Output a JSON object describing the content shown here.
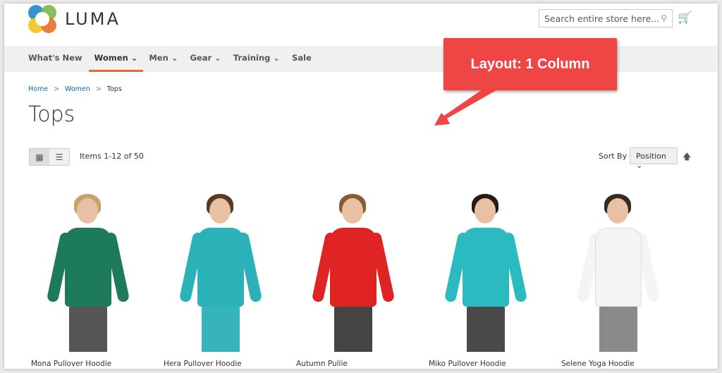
{
  "header": {
    "logo_text": "LUMA",
    "search_placeholder": "Search entire store here...",
    "icons": {
      "search": "search-icon",
      "cart": "cart-icon"
    }
  },
  "nav": {
    "items": [
      {
        "label": "What's New"
      },
      {
        "label": "Women",
        "caret": "⌄",
        "active": true
      },
      {
        "label": "Men",
        "caret": "⌄"
      },
      {
        "label": "Gear",
        "caret": "⌄"
      },
      {
        "label": "Training",
        "caret": "⌄"
      },
      {
        "label": "Sale"
      }
    ],
    "active_color": "#e16f2f"
  },
  "breadcrumb": [
    "Home",
    "Women",
    "Tops"
  ],
  "page_title": "Tops",
  "toolbar": {
    "amount": "Items 1-12 of 50",
    "sort_label": "Sort By",
    "sort_value": "Position",
    "view_modes": [
      "grid",
      "list"
    ]
  },
  "annotation": {
    "text": "Layout: 1 Column",
    "color": "#f04545"
  },
  "products": [
    {
      "name": "Mona Pullover Hoodie",
      "color": "#1d7a5a",
      "hair": "#c9a26a",
      "legs": "#555"
    },
    {
      "name": "Hera Pullover Hoodie",
      "color": "#2bb1b8",
      "hair": "#5a3a22",
      "legs": "#36b3bb"
    },
    {
      "name": "Autumn Pullie",
      "color": "#e02424",
      "hair": "#8a5a33",
      "legs": "#444"
    },
    {
      "name": "Miko Pullover Hoodie",
      "color": "#2bbac0",
      "hair": "#2a1a12",
      "legs": "#4a4a4a"
    },
    {
      "name": "Selene Yoga Hoodie",
      "color": "#f4f4f4",
      "hair": "#3a2a1a",
      "legs": "#8a8a8a"
    }
  ]
}
